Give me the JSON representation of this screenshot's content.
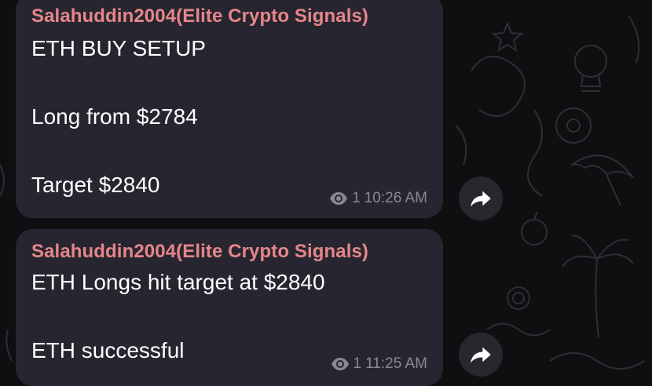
{
  "messages": [
    {
      "sender": "Salahuddin2004(Elite Crypto Signals)",
      "text": "ETH BUY SETUP\n\nLong from $2784\n\nTarget $2840",
      "views": "1",
      "time": "10:26 AM"
    },
    {
      "sender": "Salahuddin2004(Elite Crypto Signals)",
      "text": "ETH Longs hit target at $2840\n\nETH successful",
      "views": "1",
      "time": "11:25 AM"
    }
  ],
  "colors": {
    "background": "#0f0f11",
    "bubble": "#272630",
    "sender": "#e6868a",
    "text": "#ffffff",
    "meta": "#8a8991"
  },
  "icons": {
    "views": "eye-icon",
    "forward": "forward-arrow-icon"
  }
}
